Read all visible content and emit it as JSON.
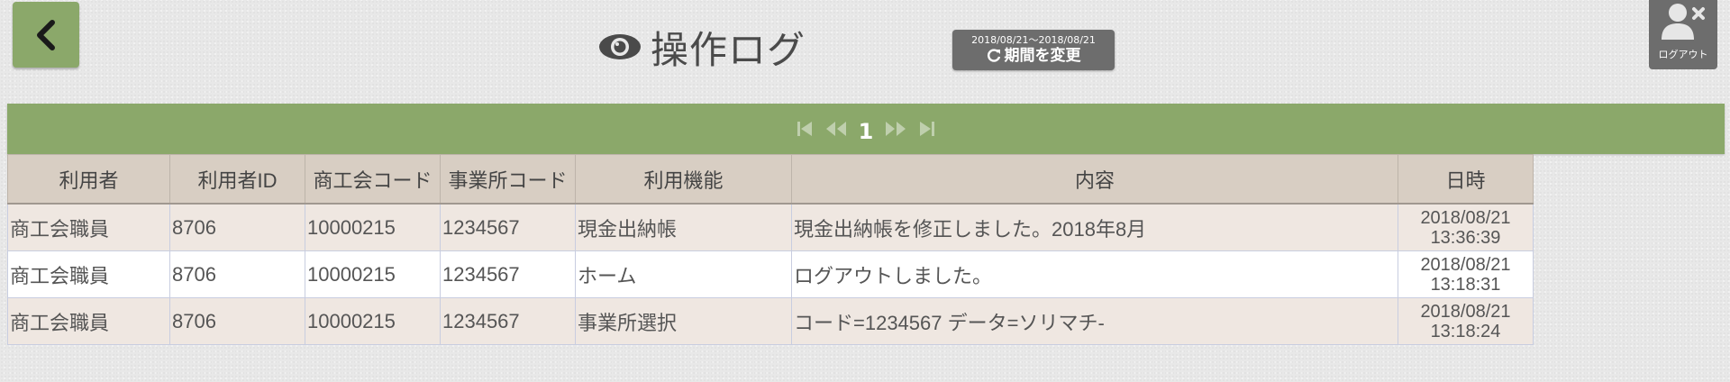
{
  "header": {
    "title": "操作ログ",
    "period_range": "2018/08/21～2018/08/21",
    "period_label": "期間を変更",
    "logout_label": "ログアウト"
  },
  "pager": {
    "current_page": "1"
  },
  "table": {
    "headers": [
      "利用者",
      "利用者ID",
      "商工会コード",
      "事業所コード",
      "利用機能",
      "内容",
      "日時"
    ],
    "rows": [
      [
        "商工会職員",
        "8706",
        "10000215",
        "1234567",
        "現金出納帳",
        "現金出納帳を修正しました。2018年8月",
        "2018/08/21",
        "13:36:39"
      ],
      [
        "商工会職員",
        "8706",
        "10000215",
        "1234567",
        "ホーム",
        "ログアウトしました。",
        "2018/08/21",
        "13:18:31"
      ],
      [
        "商工会職員",
        "8706",
        "10000215",
        "1234567",
        "事業所選択",
        "コード=1234567 データ=ソリマチ-",
        "2018/08/21",
        "13:18:24"
      ]
    ]
  },
  "colors": {
    "accent_green": "#8ba86a",
    "header_row": "#d8cec3",
    "dark_button": "#6d6d6d"
  }
}
